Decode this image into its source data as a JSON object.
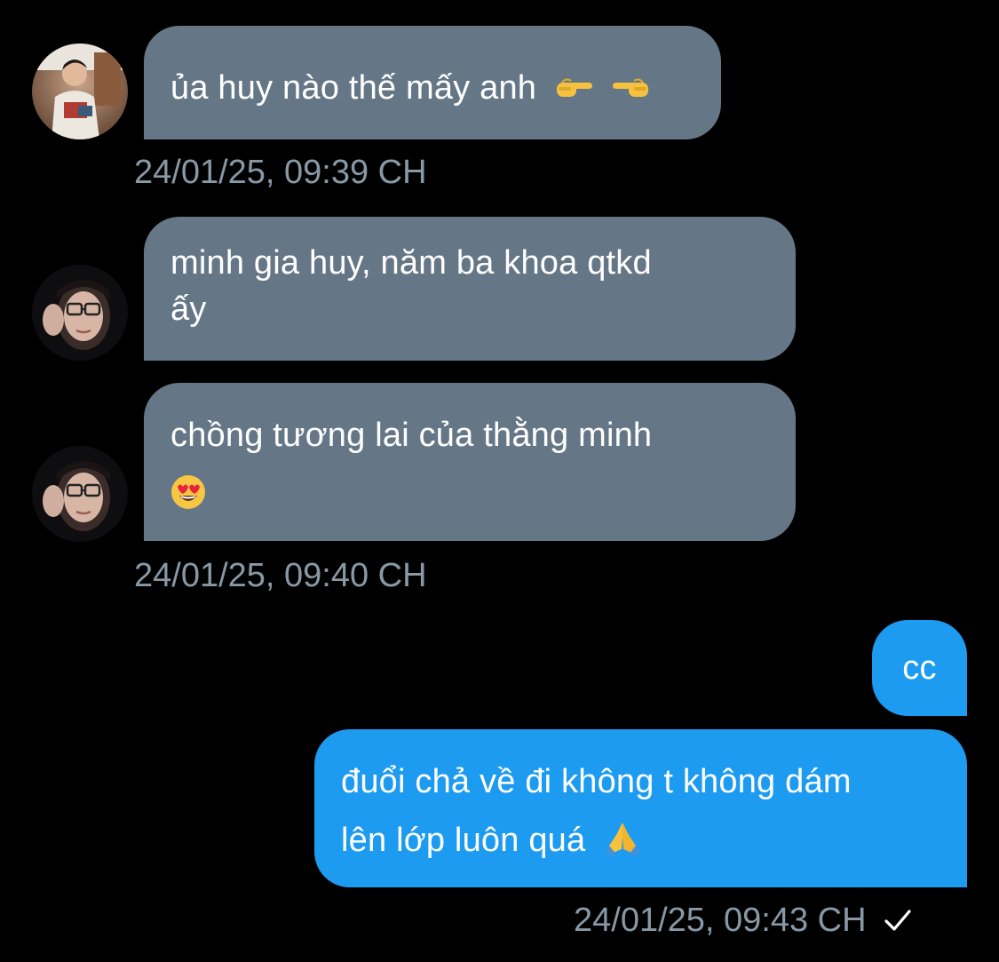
{
  "messages": [
    {
      "sender": "other",
      "avatar_icon": "avatar-photo-man",
      "text": "ủa huy nào thế mấy anh",
      "emojis": [
        "backhand-index-pointing-right-emoji",
        "backhand-index-pointing-left-emoji"
      ],
      "timestamp": "24/01/25, 09:39 CH"
    },
    {
      "sender": "other",
      "avatar_icon": "avatar-photo-girl-glasses",
      "line1": "minh gia huy, năm ba khoa qtkd",
      "line2": "ấy"
    },
    {
      "sender": "other",
      "avatar_icon": "avatar-photo-girl-glasses",
      "text": "chồng tương lai của thằng minh",
      "emojis": [
        "heart-eyes-emoji"
      ],
      "timestamp": "24/01/25, 09:40 CH"
    },
    {
      "sender": "me",
      "text": "cc"
    },
    {
      "sender": "me",
      "line1": "đuổi chả về đi không t không dám",
      "line2": "lên lớp luôn quá",
      "emojis": [
        "folded-hands-emoji"
      ],
      "timestamp": "24/01/25, 09:43 CH",
      "status_icon": "read-check-icon"
    }
  ],
  "colors": {
    "background": "#000000",
    "incoming_bubble": "#657786",
    "outgoing_bubble": "#1d9bf0",
    "timestamp": "#8899a6"
  }
}
